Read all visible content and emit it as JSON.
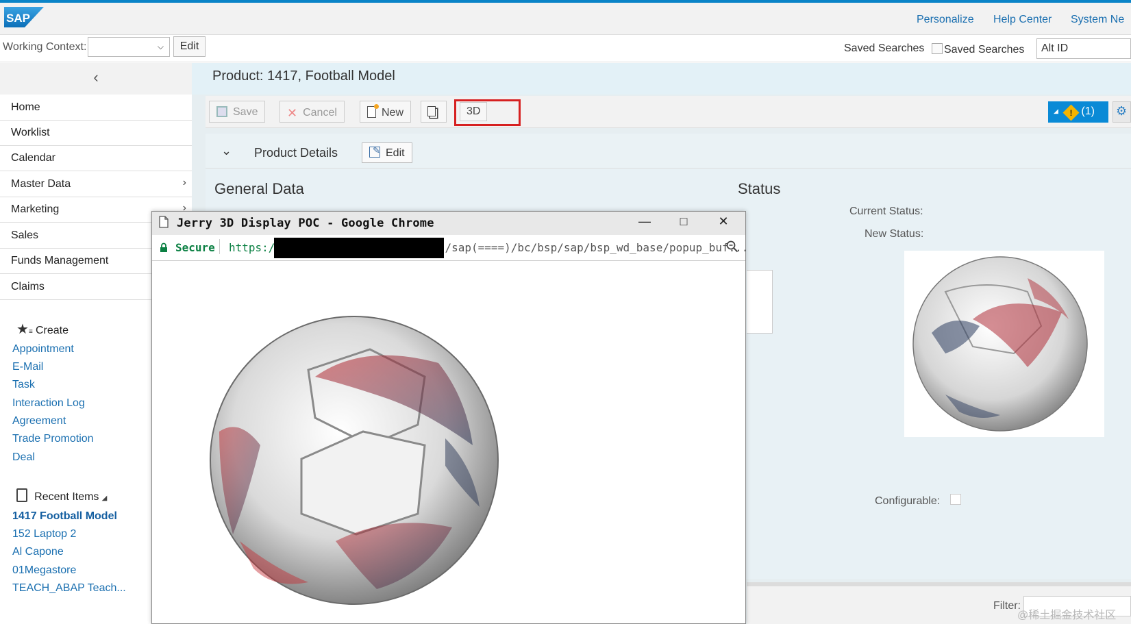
{
  "header": {
    "logo": "SAP",
    "links": [
      "Personalize",
      "Help Center",
      "System Ne"
    ],
    "brand_color": "#0a84c8"
  },
  "context": {
    "label": "Working Context:",
    "select_value": "",
    "edit_label": "Edit",
    "saved_searches_label": "Saved Searches",
    "saved_searches_img_alt": "Saved Searches",
    "search_value": "Alt ID"
  },
  "nav": {
    "collapse_icon": "chevron-left-icon",
    "items": [
      {
        "label": "Home",
        "has_sub": false
      },
      {
        "label": "Worklist",
        "has_sub": false
      },
      {
        "label": "Calendar",
        "has_sub": false
      },
      {
        "label": "Master Data",
        "has_sub": true
      },
      {
        "label": "Marketing",
        "has_sub": true
      },
      {
        "label": "Sales",
        "has_sub": false
      },
      {
        "label": "Funds Management",
        "has_sub": false
      },
      {
        "label": "Claims",
        "has_sub": false
      }
    ],
    "create": {
      "title": "Create",
      "links": [
        "Appointment",
        "E-Mail",
        "Task",
        "Interaction Log",
        "Agreement",
        "Trade Promotion",
        "Deal"
      ]
    },
    "recent": {
      "title": "Recent Items",
      "links": [
        "1417 Football Model",
        "152 Laptop 2",
        "Al Capone",
        "01Megastore",
        "TEACH_ABAP Teach..."
      ]
    }
  },
  "main": {
    "title": "Product: 1417, Football Model",
    "toolbar": {
      "save": "Save",
      "cancel": "Cancel",
      "new": "New",
      "three_d": "3D",
      "messages": "(1)"
    },
    "panel": {
      "title": "Product Details",
      "edit": "Edit",
      "general_title": "General Data",
      "status_title": "Status",
      "current_status_label": "Current Status:",
      "new_status_label": "New Status:",
      "configurable_label": "Configurable:"
    },
    "filter_label": "Filter:"
  },
  "popup": {
    "title": "Jerry 3D Display POC - Google Chrome",
    "secure_label": "Secure",
    "url_scheme": "https:/",
    "url_rest": "/sap(====)/bc/bsp/sap/bsp_wd_base/popup_buf..."
  },
  "watermark": "@稀土掘金技术社区"
}
